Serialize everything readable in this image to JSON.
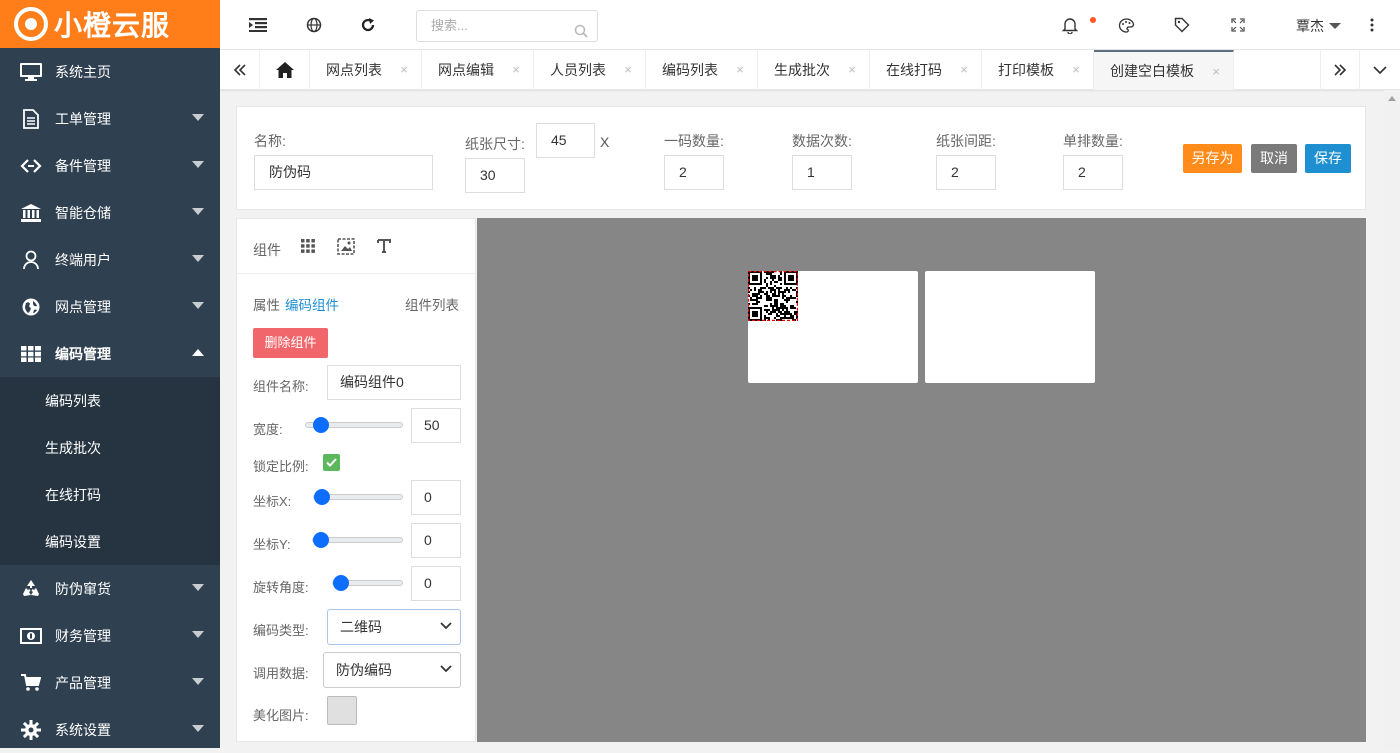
{
  "app": {
    "logo_text": "小橙云服",
    "brand_color": "#ff7e1a",
    "sidebar_color": "#2f4050",
    "sub_color": "#263442"
  },
  "sidebar": {
    "items": [
      {
        "label": "系统主页",
        "icon": "monitor-icon"
      },
      {
        "label": "工单管理",
        "icon": "document-icon"
      },
      {
        "label": "备件管理",
        "icon": "link-icon"
      },
      {
        "label": "智能仓储",
        "icon": "bank-icon"
      },
      {
        "label": "终端用户",
        "icon": "user-icon"
      },
      {
        "label": "网点管理",
        "icon": "globe-icon"
      },
      {
        "label": "编码管理",
        "icon": "grid-icon"
      },
      {
        "label": "防伪窜货",
        "icon": "recycle-icon"
      },
      {
        "label": "财务管理",
        "icon": "money-icon"
      },
      {
        "label": "产品管理",
        "icon": "cart-icon"
      },
      {
        "label": "系统设置",
        "icon": "gear-icon"
      }
    ],
    "sub_items": [
      "编码列表",
      "生成批次",
      "在线打码",
      "编码设置"
    ]
  },
  "topbar": {
    "search_placeholder": "搜索...",
    "username": "覃杰",
    "notification_color": "#ff5722"
  },
  "tabs": [
    "网点列表",
    "网点编辑",
    "人员列表",
    "编码列表",
    "生成批次",
    "在线打码",
    "打印模板",
    "创建空白模板"
  ],
  "tab_close": "×",
  "form": {
    "name_label": "名称:",
    "name_value": "防伪码",
    "paper_label": "纸张尺寸:",
    "paper_w": "45",
    "paper_x": "X",
    "paper_h": "30",
    "count_label": "一码数量:",
    "count_value": "2",
    "times_label": "数据次数:",
    "times_value": "1",
    "gap_label": "纸张间距:",
    "gap_value": "2",
    "row_label": "单排数量:",
    "row_value": "2",
    "saveas": "另存为",
    "cancel": "取消",
    "save": "保存"
  },
  "panel": {
    "components_label": "组件",
    "attr_label": "属性",
    "attr_link": "编码组件",
    "list_link": "组件列表",
    "delete_btn": "删除组件",
    "name_label": "组件名称:",
    "name_value": "编码组件0",
    "width_label": "宽度:",
    "width_value": "50",
    "lock_label": "锁定比例:",
    "x_label": "坐标X:",
    "x_value": "0",
    "y_label": "坐标Y:",
    "y_value": "0",
    "rot_label": "旋转角度:",
    "rot_value": "0",
    "type_label": "编码类型:",
    "type_value": "二维码",
    "data_label": "调用数据:",
    "data_value": "防伪编码",
    "img_label": "美化图片:"
  }
}
